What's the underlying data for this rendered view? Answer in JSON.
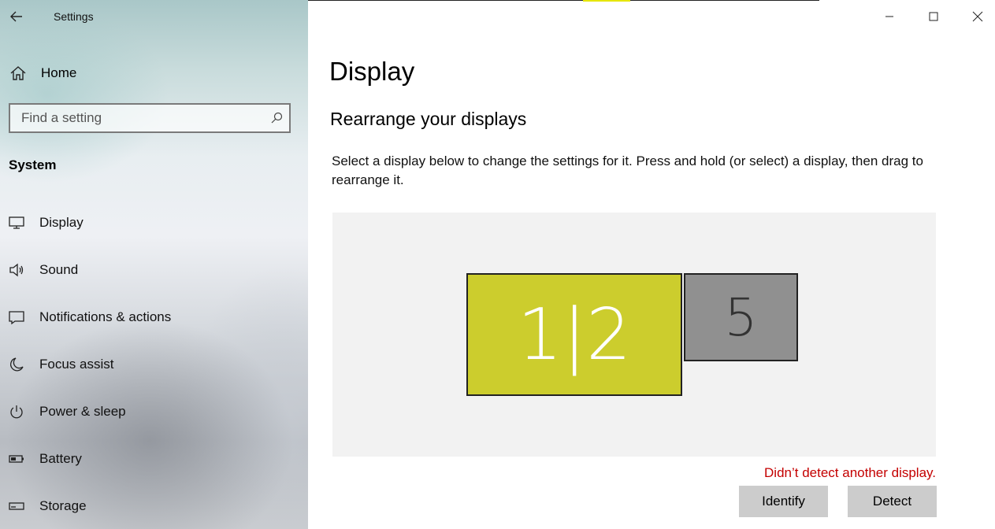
{
  "app": {
    "title": "Settings"
  },
  "sidebar": {
    "home_label": "Home",
    "search": {
      "placeholder": "Find a setting",
      "value": ""
    },
    "section_title": "System",
    "items": [
      {
        "label": "Display",
        "icon": "monitor-icon"
      },
      {
        "label": "Sound",
        "icon": "speaker-icon"
      },
      {
        "label": "Notifications & actions",
        "icon": "notification-icon"
      },
      {
        "label": "Focus assist",
        "icon": "moon-icon"
      },
      {
        "label": "Power & sleep",
        "icon": "power-icon"
      },
      {
        "label": "Battery",
        "icon": "battery-icon"
      },
      {
        "label": "Storage",
        "icon": "storage-icon"
      }
    ]
  },
  "main": {
    "title": "Display",
    "subtitle": "Rearrange your displays",
    "description": "Select a display below to change the settings for it. Press and hold (or select) a display, then drag to rearrange it.",
    "displays": [
      {
        "label": "1|2",
        "selected": true,
        "color": "#cccd2d"
      },
      {
        "label": "5",
        "selected": false,
        "color": "#909090"
      }
    ],
    "error_text": "Didn’t detect another display.",
    "identify_label": "Identify",
    "detect_label": "Detect"
  },
  "colors": {
    "accent": "#cccd2d",
    "error": "#c40000",
    "button": "#cccccc"
  }
}
